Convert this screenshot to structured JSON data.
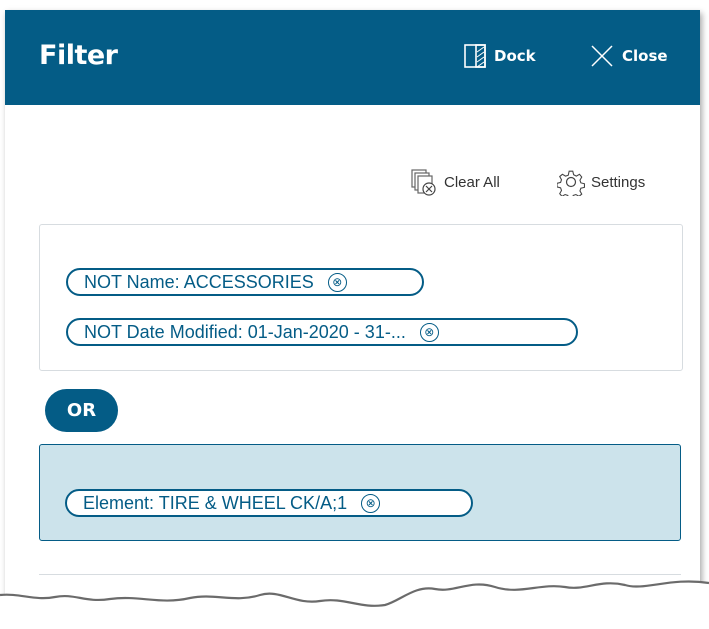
{
  "header": {
    "title": "Filter",
    "dock_label": "Dock",
    "close_label": "Close",
    "background": "#045c86"
  },
  "toolbar": {
    "clear_all_label": "Clear All",
    "settings_label": "Settings"
  },
  "group1": {
    "chips": [
      {
        "label": "NOT Name: ACCESSORIES"
      },
      {
        "label": "NOT Date Modified: 01-Jan-2020 - 31-..."
      }
    ]
  },
  "operator": {
    "label": "OR"
  },
  "group2": {
    "background": "#cce3eb",
    "chips": [
      {
        "label": "Element: TIRE & WHEEL CK/A;1"
      }
    ]
  },
  "icons": {
    "remove": "⊗"
  }
}
